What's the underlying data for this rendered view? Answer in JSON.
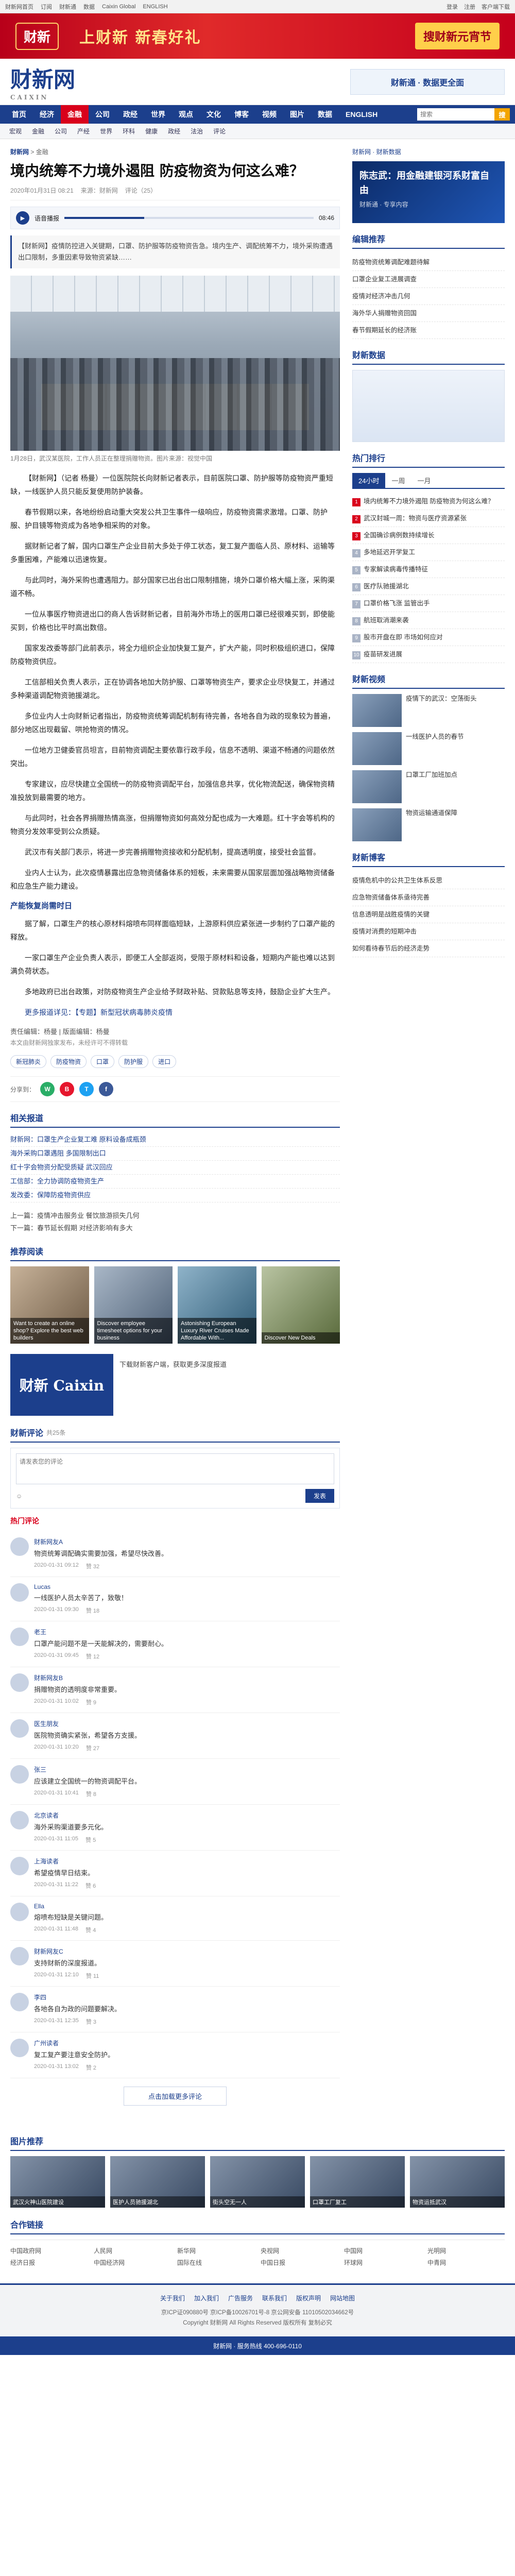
{
  "topbar": {
    "left": [
      "财新网首页",
      "订阅",
      "财新通",
      "数据",
      "Caixin Global",
      "ENGLISH"
    ],
    "right": [
      "登录",
      "注册",
      "客户端下载"
    ]
  },
  "banner": {
    "logo": "财新",
    "slogan": "上财新 新春好礼",
    "tag": "搜财新元宵节"
  },
  "header": {
    "brand": "财新网",
    "brand_en": "CAIXIN",
    "ad": "财新通 · 数据更全面"
  },
  "nav": {
    "items": [
      "首页",
      "经济",
      "金融",
      "公司",
      "政经",
      "世界",
      "观点",
      "文化",
      "博客",
      "视频",
      "图片",
      "数据",
      "ENGLISH"
    ],
    "active": 2,
    "search_placeholder": "搜索",
    "search_button": "搜"
  },
  "subnav": [
    "宏观",
    "金融",
    "公司",
    "产经",
    "世界",
    "环科",
    "健康",
    "政经",
    "法治",
    "评论"
  ],
  "article": {
    "crumb_label": "财新网",
    "crumb_sep": " > ",
    "crumb_channel": "金融",
    "title": "境内统筹不力境外遏阻 防疫物资为何这么难？",
    "date": "2020年01月31日 08:21",
    "source": "来源：财新网",
    "comments_count": "评论（25）",
    "audio_label": "语音播报",
    "audio_time": "08:46",
    "audio_progress": 0.32,
    "lede": "【财新网】疫情防控进入关键期，口罩、防护服等防疫物资告急。境内生产、调配统筹不力，境外采购遭遇出口限制，多重因素导致物资紧缺……",
    "caption": "1月28日，武汉某医院，工作人员正在整理捐赠物资。图片来源：视觉中国",
    "paragraphs": [
      "【财新网】（记者 杨曼）一位医院院长向财新记者表示，目前医院口罩、防护服等防疫物资严重短缺，一线医护人员只能反复使用防护装备。",
      "春节假期以来，各地纷纷启动重大突发公共卫生事件一级响应，防疫物资需求激增。口罩、防护服、护目镜等物资成为各地争相采购的对象。",
      "据财新记者了解，国内口罩生产企业目前大多处于停工状态，复工复产面临人员、原材料、运输等多重困难，产能难以迅速恢复。",
      "与此同时，海外采购也遭遇阻力。部分国家已出台出口限制措施，境外口罩价格大幅上涨，采购渠道不畅。",
      "一位从事医疗物资进出口的商人告诉财新记者，目前海外市场上的医用口罩已经很难买到，即使能买到，价格也比平时高出数倍。",
      "国家发改委等部门此前表示，将全力组织企业加快复工复产，扩大产能，同时积极组织进口，保障防疫物资供应。",
      "工信部相关负责人表示，正在协调各地加大防护服、口罩等物资生产，要求企业尽快复工，并通过多种渠道调配物资驰援湖北。",
      "多位业内人士向财新记者指出，防疫物资统筹调配机制有待完善，各地各自为政的现象较为普遍，部分地区出现截留、哄抢物资的情况。",
      "一位地方卫健委官员坦言，目前物资调配主要依靠行政手段，信息不透明、渠道不畅通的问题依然突出。",
      "专家建议，应尽快建立全国统一的防疫物资调配平台，加强信息共享，优化物流配送，确保物资精准投放到最需要的地方。",
      "与此同时，社会各界捐赠热情高涨，但捐赠物资如何高效分配也成为一大难题。红十字会等机构的物资分发效率受到公众质疑。",
      "武汉市有关部门表示，将进一步完善捐赠物资接收和分配机制，提高透明度，接受社会监督。",
      "业内人士认为，此次疫情暴露出应急物资储备体系的短板，未来需要从国家层面加强战略物资储备和应急生产能力建设。"
    ],
    "subhead": "产能恢复尚需时日",
    "paragraphs2": [
      "据了解，口罩生产的核心原材料熔喷布同样面临短缺，上游原料供应紧张进一步制约了口罩产能的释放。",
      "一家口罩生产企业负责人表示，即便工人全部返岗，受限于原材料和设备，短期内产能也难以达到满负荷状态。",
      "多地政府已出台政策，对防疫物资生产企业给予财政补贴、贷款贴息等支持，鼓励企业扩大生产。"
    ],
    "link_text": "更多报道详见：【专题】新型冠状病毒肺炎疫情",
    "author": "责任编辑：杨曼 | 版面编辑：杨曼",
    "editor": "本文由财新网独家发布，未经许可不得转载",
    "tags": [
      "新冠肺炎",
      "防疫物资",
      "口罩",
      "防护服",
      "进口"
    ],
    "share_label": "分享到："
  },
  "related": {
    "title": "相关报道",
    "items": [
      "财新网：口罩生产企业复工难 原料设备成瓶颈",
      "海外采购口罩遇阻 多国限制出口",
      "红十字会物资分配受质疑 武汉回应",
      "工信部：全力协调防疫物资生产",
      "发改委：保障防疫物资供应"
    ]
  },
  "prevnext": {
    "prev": "上一篇：疫情冲击服务业 餐饮旅游损失几何",
    "next": "下一篇：春节延长假期 对经济影响有多大"
  },
  "promo": {
    "title": "推荐阅读",
    "items": [
      "Want to create an online shop? Explore the best web builders",
      "Discover employee timesheet options for your business",
      "Astonishing European Luxury River Cruises Made Affordable With...",
      "Discover New Deals"
    ]
  },
  "caixin_card": {
    "logo": "财新 Caixin",
    "text": "下载财新客户端，获取更多深度报道"
  },
  "comments": {
    "title": "财新评论",
    "count_label": "共25条",
    "placeholder": "请发表您的评论",
    "submit": "发表",
    "hot_label": "热门评论",
    "items": [
      {
        "name": "财新网友A",
        "text": "物资统筹调配确实需要加强，希望尽快改善。",
        "time": "2020-01-31 09:12",
        "likes": "赞 32"
      },
      {
        "name": "Lucas",
        "text": "一线医护人员太辛苦了，致敬！",
        "time": "2020-01-31 09:30",
        "likes": "赞 18"
      },
      {
        "name": "老王",
        "text": "口罩产能问题不是一天能解决的，需要耐心。",
        "time": "2020-01-31 09:45",
        "likes": "赞 12"
      },
      {
        "name": "财新网友B",
        "text": "捐赠物资的透明度非常重要。",
        "time": "2020-01-31 10:02",
        "likes": "赞 9"
      },
      {
        "name": "医生朋友",
        "text": "医院物资确实紧张，希望各方支援。",
        "time": "2020-01-31 10:20",
        "likes": "赞 27"
      },
      {
        "name": "张三",
        "text": "应该建立全国统一的物资调配平台。",
        "time": "2020-01-31 10:41",
        "likes": "赞 8"
      },
      {
        "name": "北京读者",
        "text": "海外采购渠道要多元化。",
        "time": "2020-01-31 11:05",
        "likes": "赞 5"
      },
      {
        "name": "上海读者",
        "text": "希望疫情早日结束。",
        "time": "2020-01-31 11:22",
        "likes": "赞 6"
      },
      {
        "name": "Ella",
        "text": "熔喷布短缺是关键问题。",
        "time": "2020-01-31 11:48",
        "likes": "赞 4"
      },
      {
        "name": "财新网友C",
        "text": "支持财新的深度报道。",
        "time": "2020-01-31 12:10",
        "likes": "赞 11"
      },
      {
        "name": "李四",
        "text": "各地各自为政的问题要解决。",
        "time": "2020-01-31 12:35",
        "likes": "赞 3"
      },
      {
        "name": "广州读者",
        "text": "复工复产要注意安全防护。",
        "time": "2020-01-31 13:02",
        "likes": "赞 2"
      }
    ],
    "more": "点击加载更多评论"
  },
  "sidebar": {
    "top_links": "财新网 · 财新数据",
    "ad_title": "陈志武：用金融建银河系财富自由",
    "ad_sub": "财新通 · 专享内容",
    "box1_title": "编辑推荐",
    "box1_items": [
      "防疫物资统筹调配难题待解",
      "口罩企业复工进展调查",
      "疫情对经济冲击几何",
      "海外华人捐赠物资回国",
      "春节假期延长的经济账"
    ],
    "box2_title": "财新数据",
    "box3_title": "热门排行",
    "tabs": [
      "24小时",
      "一周",
      "一月"
    ],
    "rank_items": [
      "境内统筹不力境外遏阻 防疫物资为何这么难？",
      "武汉封城一周：物资与医疗资源紧张",
      "全国确诊病例数持续增长",
      "多地延迟开学复工",
      "专家解读病毒传播特征",
      "医疗队驰援湖北",
      "口罩价格飞涨 监管出手",
      "航班取消潮来袭",
      "股市开盘在即 市场如何应对",
      "疫苗研发进展"
    ],
    "box4_title": "财新视频",
    "thumbs": [
      "疫情下的武汉：空荡街头",
      "一线医护人员的春节",
      "口罩工厂加班加点",
      "物资运输通道保障"
    ],
    "box5_title": "财新博客",
    "blog_items": [
      "疫情危机中的公共卫生体系反思",
      "应急物资储备体系亟待完善",
      "信息透明是战胜疫情的关键",
      "疫情对消费的短期冲击",
      "如何看待春节后的经济走势"
    ]
  },
  "hotphoto": {
    "title": "图片推荐",
    "items": [
      "武汉火神山医院建设",
      "医护人员驰援湖北",
      "街头空无一人",
      "口罩工厂复工",
      "物资运抵武汉"
    ]
  },
  "links": {
    "title": "合作链接",
    "items": [
      "中国政府网",
      "人民网",
      "新华网",
      "央视网",
      "中国网",
      "光明网",
      "经济日报",
      "中国经济网",
      "国际在线",
      "中国日报",
      "环球网",
      "中青网"
    ]
  },
  "footer": {
    "nav": [
      "关于我们",
      "加入我们",
      "广告服务",
      "联系我们",
      "版权声明",
      "网站地图"
    ],
    "line1": "京ICP证090880号 京ICP备10026701号-8 京公网安备 11010502034662号",
    "line2": "Copyright 财新网 All Rights Reserved 版权所有 复制必究",
    "bottom": "财新网 · 服务热线 400-696-0110"
  }
}
